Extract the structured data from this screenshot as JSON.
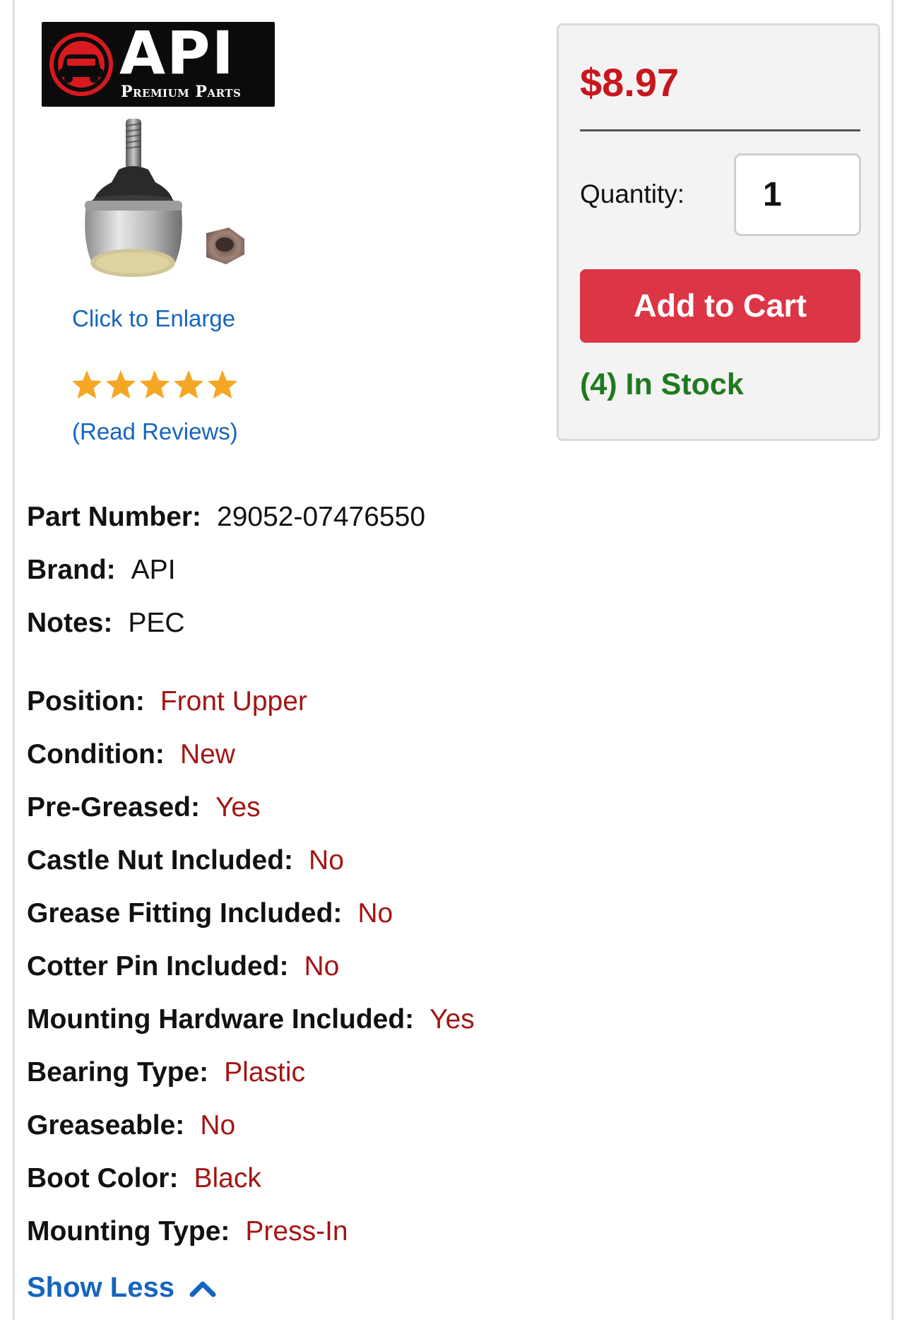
{
  "brand_logo": {
    "wordmark": "API",
    "tagline": "Premium Parts"
  },
  "product": {
    "image_name": "ball joint with nut",
    "enlarge_label": "Click to Enlarge",
    "rating_stars": 5,
    "reviews_label": "(Read Reviews)"
  },
  "purchase": {
    "price": "$8.97",
    "quantity_label": "Quantity:",
    "quantity_value": "1",
    "add_to_cart_label": "Add to Cart",
    "stock_status": "(4) In Stock"
  },
  "specs": [
    {
      "label": "Part Number:",
      "value": "29052-07476550",
      "tone": "black"
    },
    {
      "label": "Brand:",
      "value": "API",
      "tone": "black"
    },
    {
      "label": "Notes:",
      "value": "PEC",
      "tone": "black"
    },
    {
      "label": "Position:",
      "value": "Front Upper",
      "tone": "red"
    },
    {
      "label": "Condition:",
      "value": "New",
      "tone": "red"
    },
    {
      "label": "Pre-Greased:",
      "value": "Yes",
      "tone": "red"
    },
    {
      "label": "Castle Nut Included:",
      "value": "No",
      "tone": "red"
    },
    {
      "label": "Grease Fitting Included:",
      "value": "No",
      "tone": "red"
    },
    {
      "label": "Cotter Pin Included:",
      "value": "No",
      "tone": "red"
    },
    {
      "label": "Mounting Hardware Included:",
      "value": "Yes",
      "tone": "red"
    },
    {
      "label": "Bearing Type:",
      "value": "Plastic",
      "tone": "red"
    },
    {
      "label": "Greaseable:",
      "value": "No",
      "tone": "red"
    },
    {
      "label": "Boot Color:",
      "value": "Black",
      "tone": "red"
    },
    {
      "label": "Mounting Type:",
      "value": "Press-In",
      "tone": "red"
    }
  ],
  "toggle": {
    "label": "Show Less",
    "icon": "chevron-up-icon"
  },
  "colors": {
    "price_red": "#c8171e",
    "button_red": "#dc3545",
    "stock_green": "#1f7a1f",
    "link_blue": "#1565c0",
    "value_red": "#a31515",
    "star_orange": "#f5a623"
  }
}
